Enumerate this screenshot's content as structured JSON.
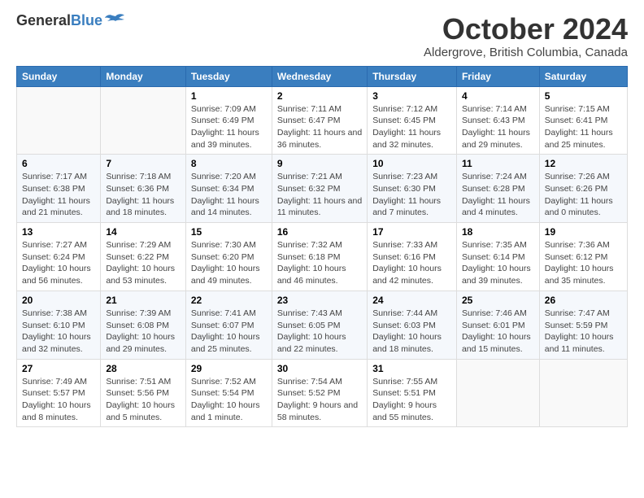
{
  "header": {
    "logo_general": "General",
    "logo_blue": "Blue",
    "title": "October 2024",
    "subtitle": "Aldergrove, British Columbia, Canada"
  },
  "columns": [
    "Sunday",
    "Monday",
    "Tuesday",
    "Wednesday",
    "Thursday",
    "Friday",
    "Saturday"
  ],
  "weeks": [
    [
      {
        "day": "",
        "info": ""
      },
      {
        "day": "",
        "info": ""
      },
      {
        "day": "1",
        "info": "Sunrise: 7:09 AM\nSunset: 6:49 PM\nDaylight: 11 hours and 39 minutes."
      },
      {
        "day": "2",
        "info": "Sunrise: 7:11 AM\nSunset: 6:47 PM\nDaylight: 11 hours and 36 minutes."
      },
      {
        "day": "3",
        "info": "Sunrise: 7:12 AM\nSunset: 6:45 PM\nDaylight: 11 hours and 32 minutes."
      },
      {
        "day": "4",
        "info": "Sunrise: 7:14 AM\nSunset: 6:43 PM\nDaylight: 11 hours and 29 minutes."
      },
      {
        "day": "5",
        "info": "Sunrise: 7:15 AM\nSunset: 6:41 PM\nDaylight: 11 hours and 25 minutes."
      }
    ],
    [
      {
        "day": "6",
        "info": "Sunrise: 7:17 AM\nSunset: 6:38 PM\nDaylight: 11 hours and 21 minutes."
      },
      {
        "day": "7",
        "info": "Sunrise: 7:18 AM\nSunset: 6:36 PM\nDaylight: 11 hours and 18 minutes."
      },
      {
        "day": "8",
        "info": "Sunrise: 7:20 AM\nSunset: 6:34 PM\nDaylight: 11 hours and 14 minutes."
      },
      {
        "day": "9",
        "info": "Sunrise: 7:21 AM\nSunset: 6:32 PM\nDaylight: 11 hours and 11 minutes."
      },
      {
        "day": "10",
        "info": "Sunrise: 7:23 AM\nSunset: 6:30 PM\nDaylight: 11 hours and 7 minutes."
      },
      {
        "day": "11",
        "info": "Sunrise: 7:24 AM\nSunset: 6:28 PM\nDaylight: 11 hours and 4 minutes."
      },
      {
        "day": "12",
        "info": "Sunrise: 7:26 AM\nSunset: 6:26 PM\nDaylight: 11 hours and 0 minutes."
      }
    ],
    [
      {
        "day": "13",
        "info": "Sunrise: 7:27 AM\nSunset: 6:24 PM\nDaylight: 10 hours and 56 minutes."
      },
      {
        "day": "14",
        "info": "Sunrise: 7:29 AM\nSunset: 6:22 PM\nDaylight: 10 hours and 53 minutes."
      },
      {
        "day": "15",
        "info": "Sunrise: 7:30 AM\nSunset: 6:20 PM\nDaylight: 10 hours and 49 minutes."
      },
      {
        "day": "16",
        "info": "Sunrise: 7:32 AM\nSunset: 6:18 PM\nDaylight: 10 hours and 46 minutes."
      },
      {
        "day": "17",
        "info": "Sunrise: 7:33 AM\nSunset: 6:16 PM\nDaylight: 10 hours and 42 minutes."
      },
      {
        "day": "18",
        "info": "Sunrise: 7:35 AM\nSunset: 6:14 PM\nDaylight: 10 hours and 39 minutes."
      },
      {
        "day": "19",
        "info": "Sunrise: 7:36 AM\nSunset: 6:12 PM\nDaylight: 10 hours and 35 minutes."
      }
    ],
    [
      {
        "day": "20",
        "info": "Sunrise: 7:38 AM\nSunset: 6:10 PM\nDaylight: 10 hours and 32 minutes."
      },
      {
        "day": "21",
        "info": "Sunrise: 7:39 AM\nSunset: 6:08 PM\nDaylight: 10 hours and 29 minutes."
      },
      {
        "day": "22",
        "info": "Sunrise: 7:41 AM\nSunset: 6:07 PM\nDaylight: 10 hours and 25 minutes."
      },
      {
        "day": "23",
        "info": "Sunrise: 7:43 AM\nSunset: 6:05 PM\nDaylight: 10 hours and 22 minutes."
      },
      {
        "day": "24",
        "info": "Sunrise: 7:44 AM\nSunset: 6:03 PM\nDaylight: 10 hours and 18 minutes."
      },
      {
        "day": "25",
        "info": "Sunrise: 7:46 AM\nSunset: 6:01 PM\nDaylight: 10 hours and 15 minutes."
      },
      {
        "day": "26",
        "info": "Sunrise: 7:47 AM\nSunset: 5:59 PM\nDaylight: 10 hours and 11 minutes."
      }
    ],
    [
      {
        "day": "27",
        "info": "Sunrise: 7:49 AM\nSunset: 5:57 PM\nDaylight: 10 hours and 8 minutes."
      },
      {
        "day": "28",
        "info": "Sunrise: 7:51 AM\nSunset: 5:56 PM\nDaylight: 10 hours and 5 minutes."
      },
      {
        "day": "29",
        "info": "Sunrise: 7:52 AM\nSunset: 5:54 PM\nDaylight: 10 hours and 1 minute."
      },
      {
        "day": "30",
        "info": "Sunrise: 7:54 AM\nSunset: 5:52 PM\nDaylight: 9 hours and 58 minutes."
      },
      {
        "day": "31",
        "info": "Sunrise: 7:55 AM\nSunset: 5:51 PM\nDaylight: 9 hours and 55 minutes."
      },
      {
        "day": "",
        "info": ""
      },
      {
        "day": "",
        "info": ""
      }
    ]
  ]
}
